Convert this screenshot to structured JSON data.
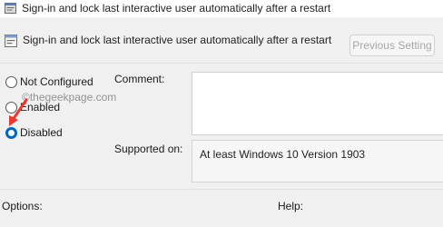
{
  "window": {
    "title": "Sign-in and lock last interactive user automatically after a restart"
  },
  "header": {
    "policy_title": "Sign-in and lock last interactive user automatically after a restart"
  },
  "toolbar": {
    "previous_setting_label": "Previous Setting"
  },
  "options": [
    {
      "label": "Not Configured",
      "checked": false
    },
    {
      "label": "Enabled",
      "checked": false
    },
    {
      "label": "Disabled",
      "checked": true
    }
  ],
  "comment": {
    "label": "Comment:",
    "value": ""
  },
  "supported_on": {
    "label": "Supported on:",
    "value": "At least Windows 10 Version 1903"
  },
  "footer": {
    "options_label": "Options:",
    "help_label": "Help:"
  },
  "watermark": "©thegeekpage.com",
  "colors": {
    "accent": "#0067c0",
    "arrow": "#e8382f"
  },
  "icons": {
    "title": "policy-window-icon",
    "policy": "policy-setting-icon",
    "annotation": "red-arrow-icon"
  }
}
